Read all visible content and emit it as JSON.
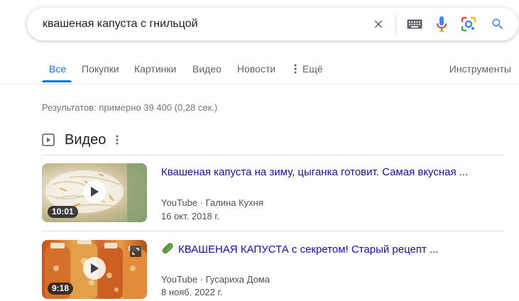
{
  "search": {
    "query": "квашеная капуста с гнильцой"
  },
  "tabs": [
    {
      "label": "Все",
      "active": true
    },
    {
      "label": "Покупки"
    },
    {
      "label": "Картинки"
    },
    {
      "label": "Видео"
    },
    {
      "label": "Новости"
    },
    {
      "label": "Ещё"
    }
  ],
  "tools_label": "Инструменты",
  "stats": "Результатов: примерно 39 400 (0,28 сек.)",
  "videos_section": {
    "title": "Видео",
    "items": [
      {
        "title": "Квашеная капуста на зиму, цыганка готовит. Самая вкусная ...",
        "source": "YouTube",
        "channel": "Галина Кухня",
        "date": "16 окт. 2018 г.",
        "duration": "10:01"
      },
      {
        "title": "КВАШЕНАЯ КАПУСТА с секретом! Старый рецепт ...",
        "source": "YouTube",
        "channel": "Гусариха Дома",
        "date": "8 нояб. 2022 г.",
        "duration": "9:18"
      }
    ]
  },
  "colors": {
    "accent": "#1a73e8",
    "link": "#1a0dab",
    "muted": "#70757a"
  }
}
